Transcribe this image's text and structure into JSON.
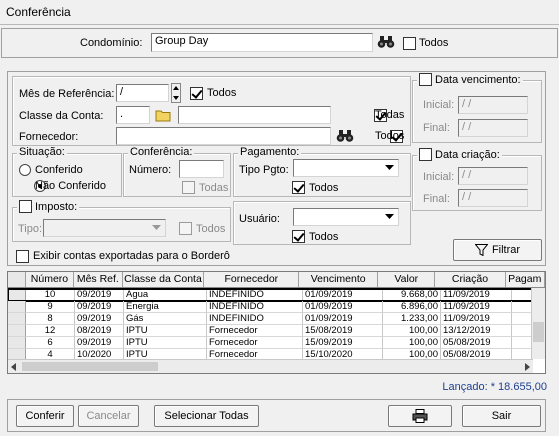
{
  "window": {
    "title": "Conferência"
  },
  "condominio": {
    "label": "Condomínio:",
    "value": "Group Day",
    "todos_label": "Todos",
    "todos_checked": false
  },
  "filters": {
    "mes_label": "Mês de Referência:",
    "mes_value": "/",
    "mes_todos_label": "Todos",
    "mes_todos_checked": true,
    "classe_label": "Classe da Conta:",
    "classe_value": ".",
    "classe_desc": "",
    "classe_todos_label": "Todas",
    "classe_todos_checked": true,
    "fornecedor_label": "Fornecedor:",
    "fornecedor_value": "",
    "fornecedor_todos_label": "Todos",
    "fornecedor_todos_checked": true
  },
  "data_vencimento": {
    "label": "Data vencimento:",
    "checked": false,
    "inicial_label": "Inicial:",
    "inicial_value": "/ /",
    "final_label": "Final:",
    "final_value": "/ /"
  },
  "data_criacao": {
    "label": "Data criação:",
    "checked": false,
    "inicial_label": "Inicial:",
    "inicial_value": "/ /",
    "final_label": "Final:",
    "final_value": "/ /"
  },
  "situacao": {
    "label": "Situação:",
    "options": [
      "Conferido",
      "Não Conferido"
    ],
    "selected": "Não Conferido"
  },
  "conferencia": {
    "label": "Conferência:",
    "numero_label": "Número:",
    "numero_value": "",
    "todas_label": "Todas",
    "todas_checked": false
  },
  "pagamento": {
    "label": "Pagamento:",
    "tipo_label": "Tipo Pgto:",
    "tipo_value": "",
    "todos_label": "Todos",
    "todos_checked": true
  },
  "imposto": {
    "label": "Imposto:",
    "checked": false,
    "tipo_label": "Tipo:",
    "tipo_value": "",
    "todos_label": "Todos",
    "todos_checked": false
  },
  "usuario": {
    "label": "Usuário:",
    "value": "",
    "todos_label": "Todos",
    "todos_checked": true
  },
  "exibir_bordero": {
    "label": "Exibir contas exportadas para o Borderô",
    "checked": false
  },
  "filtrar_button": "Filtrar",
  "table": {
    "columns": [
      "Número",
      "Mês Ref.",
      "Classe da Conta",
      "Fornecedor",
      "Vencimento",
      "Valor",
      "Criação",
      "Pagam"
    ],
    "rows": [
      [
        "10",
        "09/2019",
        "Água",
        "INDEFINIDO",
        "01/09/2019",
        "9.668,00",
        "11/09/2019"
      ],
      [
        "9",
        "09/2019",
        "Energia",
        "INDEFINIDO",
        "01/09/2019",
        "6.896,00",
        "11/09/2019"
      ],
      [
        "8",
        "09/2019",
        "Gás",
        "INDEFINIDO",
        "01/09/2019",
        "1.233,00",
        "11/09/2019"
      ],
      [
        "12",
        "08/2019",
        "IPTU",
        "Fornecedor",
        "15/08/2019",
        "100,00",
        "13/12/2019"
      ],
      [
        "6",
        "09/2019",
        "IPTU",
        "Fornecedor",
        "15/09/2019",
        "100,00",
        "05/08/2019"
      ],
      [
        "4",
        "10/2020",
        "IPTU",
        "Fornecedor",
        "15/10/2020",
        "100,00",
        "05/08/2019"
      ]
    ],
    "selected_index": 0
  },
  "lancado": "Lançado: * 18.655,00",
  "buttons": {
    "conferir": "Conferir",
    "cancelar": "Cancelar",
    "selecionar_todas": "Selecionar Todas",
    "sair": "Sair"
  },
  "colors": {
    "accent_text": "#1f3f8f",
    "folder_icon": "#f3d35f"
  },
  "icons": [
    "binoculars-icon",
    "folder-icon",
    "funnel-icon",
    "printer-icon",
    "spin-up-icon",
    "spin-down-icon",
    "dropdown-arrow-icon"
  ]
}
